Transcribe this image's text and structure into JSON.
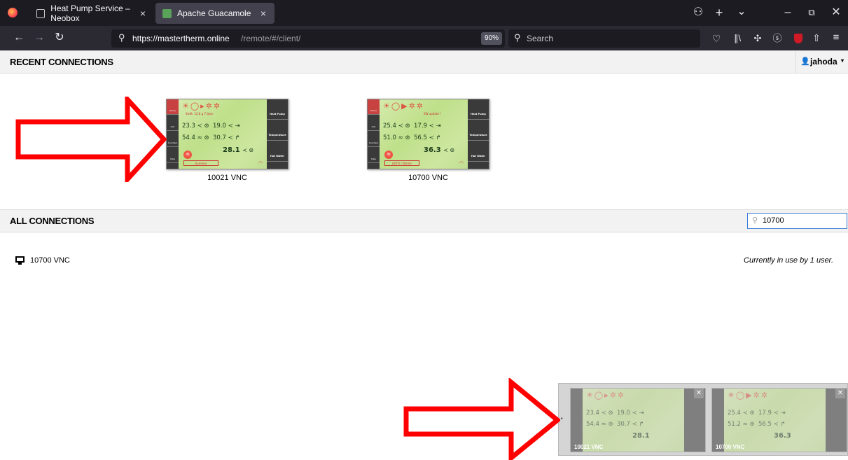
{
  "browser": {
    "tabs": [
      {
        "label": "Heat Pump Service – Neobox",
        "close": "×"
      },
      {
        "label": "Apache Guacamole",
        "close": "×"
      }
    ],
    "url": {
      "domain": "https://mastertherm.online",
      "path": "/remote/#/client/"
    },
    "zoom": "90%",
    "search_placeholder": "Search"
  },
  "user": {
    "name": "jahoda",
    "caret": "▾"
  },
  "recent": {
    "title": "RECENT CONNECTIONS",
    "items": [
      {
        "label": "10021 VNC",
        "note": "Swift: 12:8 g 7.0pm",
        "row1": "23.3",
        "row1b": "19.0",
        "row2": "54.4",
        "row2b": "30.7",
        "row3": "28.1",
        "mode": "Summer"
      },
      {
        "label": "10700 VNC",
        "note": "SW update !",
        "row1": "25.4",
        "row1b": "17.9",
        "row2": "51.0",
        "row2b": "56.5",
        "row3": "36.3",
        "mode": "AUTO / Winter"
      }
    ]
  },
  "hmi_menu": {
    "left": [
      "Home",
      "Info",
      "Counters",
      "Help"
    ],
    "right": [
      "Heat Pump",
      "Temperature",
      "Hot Water"
    ]
  },
  "all": {
    "title": "ALL CONNECTIONS",
    "filter_value": "10700",
    "items": [
      {
        "label": "10700 VNC",
        "status": "Currently in use by 1 user."
      }
    ]
  },
  "dock": {
    "items": [
      {
        "label": "10021 VNC",
        "row1": "23.4",
        "row1b": "19.0",
        "row2": "54.4",
        "row2b": "30.7",
        "row3": "28.1"
      },
      {
        "label": "10700 VNC",
        "row1": "25.4",
        "row1b": "17.9",
        "row2": "51.2",
        "row2b": "56.5",
        "row3": "36.3"
      }
    ]
  },
  "colors": {
    "arrow": "#ff0000",
    "tab_active": "#42414d",
    "chrome_dark": "#1c1b22",
    "accent_focus": "#3a7bd5"
  }
}
